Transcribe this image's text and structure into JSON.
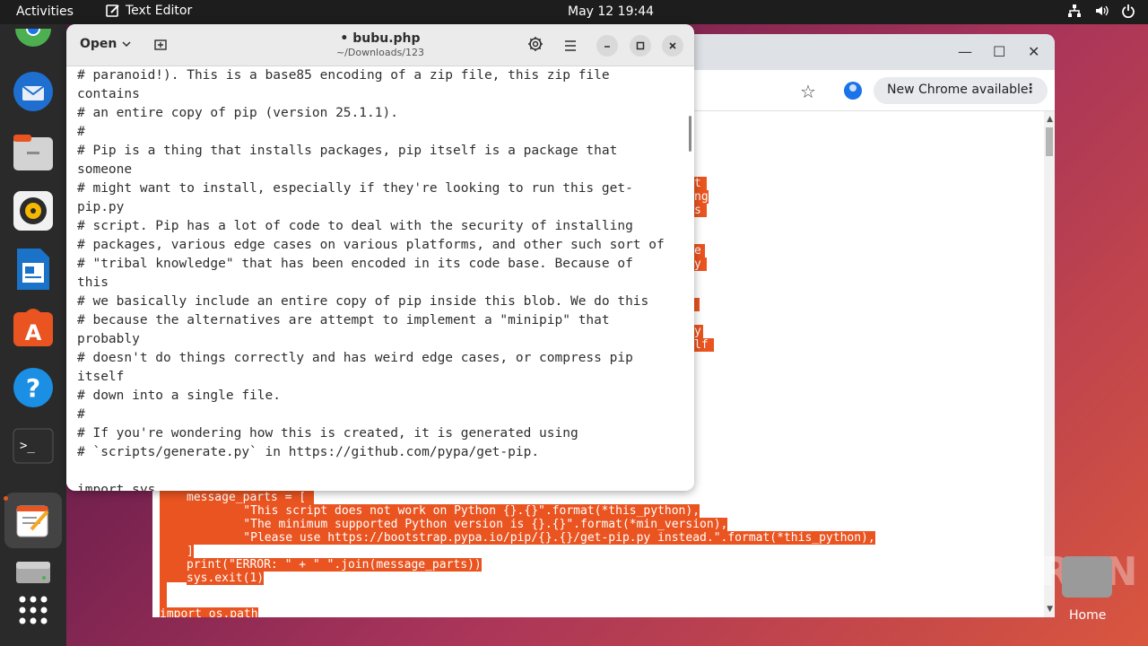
{
  "topbar": {
    "activities": "Activities",
    "app_name": "Text Editor",
    "clock": "May 12  19:44"
  },
  "dock": {
    "items": [
      "chrome-icon",
      "thunderbird-icon",
      "files-icon",
      "rhythmbox-icon",
      "writer-icon",
      "app-center-icon",
      "help-icon",
      "terminal-icon",
      "text-editor-icon",
      "disk-icon",
      "app-grid-icon"
    ]
  },
  "chrome": {
    "update_label": "New Chrome available",
    "selected_code": [
      "message_parts = [",
      "    \"This script does not work on Python {}.{}\".format(*this_python),",
      "    \"The minimum supported Python version is {}.{}\".format(*min_version),",
      "    \"Please use https://bootstrap.pypa.io/pip/{}.{}/get-pip.py instead.\".format(*this_python),",
      "]",
      "print(\"ERROR: \" + \" \".join(message_parts))",
      "sys.exit(1)",
      "import os.path"
    ],
    "edge_fragments": [
      "t",
      "ng",
      "s",
      "e",
      "y",
      "y",
      "lf"
    ]
  },
  "editor": {
    "open_label": "Open",
    "title": "• bubu.php",
    "subtitle": "~/Downloads/123",
    "lines": [
      "# paranoid!). This is a base85 encoding of a zip file, this zip file",
      "contains",
      "# an entire copy of pip (version 25.1.1).",
      "#",
      "# Pip is a thing that installs packages, pip itself is a package that",
      "someone",
      "# might want to install, especially if they're looking to run this get-",
      "pip.py",
      "# script. Pip has a lot of code to deal with the security of installing",
      "# packages, various edge cases on various platforms, and other such sort of",
      "# \"tribal knowledge\" that has been encoded in its code base. Because of",
      "this",
      "# we basically include an entire copy of pip inside this blob. We do this",
      "# because the alternatives are attempt to implement a \"minipip\" that",
      "probably",
      "# doesn't do things correctly and has weird edge cases, or compress pip",
      "itself",
      "# down into a single file.",
      "#",
      "# If you're wondering how this is created, it is generated using",
      "# `scripts/generate.py` in https://github.com/pypa/get-pip.",
      "",
      "import sys"
    ]
  },
  "desktop": {
    "home_label": "Home",
    "watermark": "ANY RUN"
  }
}
